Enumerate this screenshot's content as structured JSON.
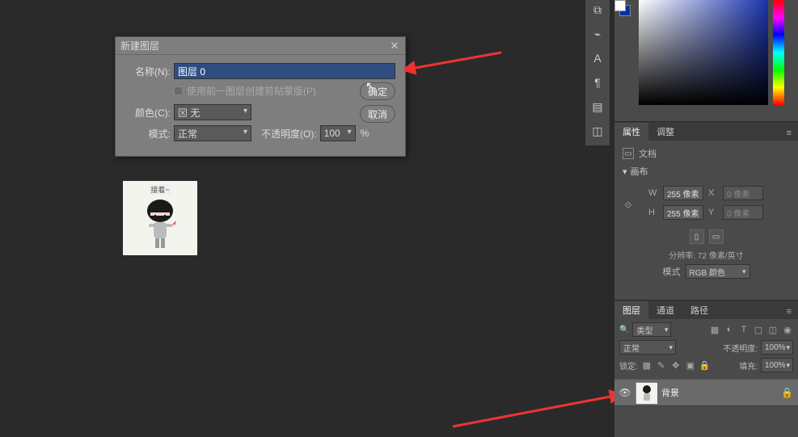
{
  "dialog": {
    "title": "新建图层",
    "name_label": "名称(N):",
    "name_value": "图层 0",
    "clip_checkbox_label": "使用前一图层创建剪贴蒙版(P)",
    "color_label": "颜色(C):",
    "color_value": "⊠ 无",
    "mode_label": "模式:",
    "mode_value": "正常",
    "opacity_label": "不透明度(O):",
    "opacity_value": "100",
    "opacity_suffix": "%",
    "ok": "确定",
    "cancel": "取消"
  },
  "thumb_caption": "接着~",
  "right_tools": [
    "⧉",
    "⌁",
    "A",
    "¶",
    "▤",
    "◫"
  ],
  "panels": {
    "props_tabs": {
      "properties": "属性",
      "adjustments": "调整"
    },
    "doc_label": "文档",
    "canvas_section": "画布",
    "W": "W",
    "H": "H",
    "X": "X",
    "Y": "Y",
    "w_val": "255 像素",
    "h_val": "255 像素",
    "x_val": "0 像素",
    "y_val": "0 像素",
    "resolution": "分辨率: 72 像素/英寸",
    "mode_label": "模式",
    "mode_value": "RGB 颜色"
  },
  "layers": {
    "tabs": {
      "layers": "图层",
      "channels": "通道",
      "paths": "路径"
    },
    "kind_label": "类型",
    "blend_value": "正常",
    "opacity_label": "不透明度:",
    "opacity_value": "100%",
    "lock_label": "锁定:",
    "fill_label": "填充:",
    "fill_value": "100%",
    "layer0_name": "背景"
  }
}
